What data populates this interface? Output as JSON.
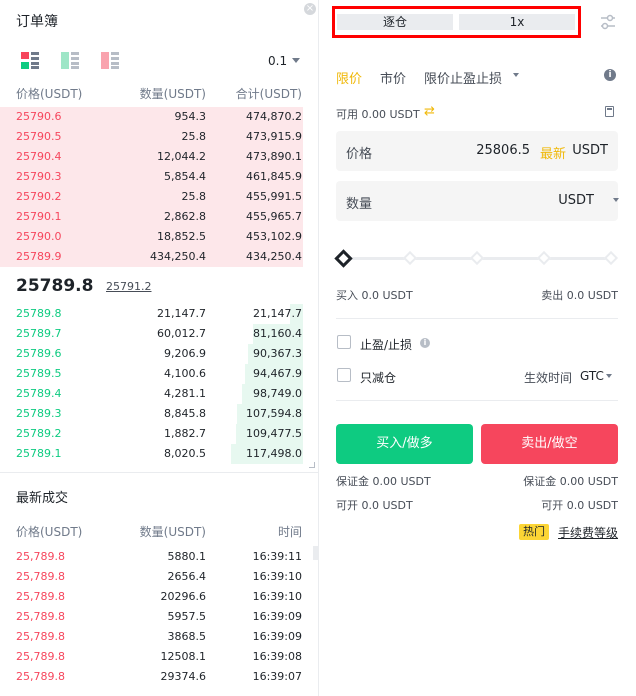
{
  "order_book": {
    "title": "订单簿",
    "close_icon": "close-icon",
    "view_icons": [
      "book-both-icon",
      "book-bids-icon",
      "book-asks-icon"
    ],
    "precision": "0.1",
    "columns": [
      "价格(USDT)",
      "数量(USDT)",
      "合计(USDT)"
    ],
    "asks": [
      {
        "price": "25790.6",
        "qty": "954.3",
        "total": "474,870.2"
      },
      {
        "price": "25790.5",
        "qty": "25.8",
        "total": "473,915.9"
      },
      {
        "price": "25790.4",
        "qty": "12,044.2",
        "total": "473,890.1"
      },
      {
        "price": "25790.3",
        "qty": "5,854.4",
        "total": "461,845.9"
      },
      {
        "price": "25790.2",
        "qty": "25.8",
        "total": "455,991.5"
      },
      {
        "price": "25790.1",
        "qty": "2,862.8",
        "total": "455,965.7"
      },
      {
        "price": "25790.0",
        "qty": "18,852.5",
        "total": "453,102.9"
      },
      {
        "price": "25789.9",
        "qty": "434,250.4",
        "total": "434,250.4"
      }
    ],
    "last_price": "25789.8",
    "mark_price": "25791.2",
    "bids": [
      {
        "price": "25789.8",
        "qty": "21,147.7",
        "total": "21,147.7"
      },
      {
        "price": "25789.7",
        "qty": "60,012.7",
        "total": "81,160.4"
      },
      {
        "price": "25789.6",
        "qty": "9,206.9",
        "total": "90,367.3"
      },
      {
        "price": "25789.5",
        "qty": "4,100.6",
        "total": "94,467.9"
      },
      {
        "price": "25789.4",
        "qty": "4,281.1",
        "total": "98,749.0"
      },
      {
        "price": "25789.3",
        "qty": "8,845.8",
        "total": "107,594.8"
      },
      {
        "price": "25789.2",
        "qty": "1,882.7",
        "total": "109,477.5"
      },
      {
        "price": "25789.1",
        "qty": "8,020.5",
        "total": "117,498.0"
      }
    ]
  },
  "trades": {
    "title": "最新成交",
    "columns": [
      "价格(USDT)",
      "数量(USDT)",
      "时间"
    ],
    "rows": [
      {
        "price": "25,789.8",
        "qty": "5880.1",
        "time": "16:39:11"
      },
      {
        "price": "25,789.8",
        "qty": "2656.4",
        "time": "16:39:10"
      },
      {
        "price": "25,789.8",
        "qty": "20296.6",
        "time": "16:39:10"
      },
      {
        "price": "25,789.8",
        "qty": "5957.5",
        "time": "16:39:09"
      },
      {
        "price": "25,789.8",
        "qty": "3868.5",
        "time": "16:39:09"
      },
      {
        "price": "25,789.8",
        "qty": "12508.1",
        "time": "16:39:08"
      },
      {
        "price": "25,789.8",
        "qty": "29374.6",
        "time": "16:39:07"
      }
    ]
  },
  "order_form": {
    "margin_mode": "逐仓",
    "leverage": "1x",
    "settings_icon": "sliders-icon",
    "tabs": [
      "限价",
      "市价",
      "限价止盈止损"
    ],
    "available": "可用 0.00 USDT",
    "price_field": {
      "label": "价格",
      "value": "25806.5",
      "latest": "最新",
      "unit": "USDT"
    },
    "qty_field": {
      "label": "数量",
      "unit": "USDT"
    },
    "buy_amount": "买入 0.0 USDT",
    "sell_amount": "卖出 0.0 USDT",
    "tp_sl_label": "止盈/止损",
    "reduce_only_label": "只减仓",
    "time_in_force_label": "生效时间",
    "time_in_force_value": "GTC",
    "buy_button": "买入/做多",
    "sell_button": "卖出/做空",
    "buy_margin": "保证金 0.00 USDT",
    "sell_margin": "保证金 0.00 USDT",
    "buy_openable": "可开 0.0 USDT",
    "sell_openable": "可开 0.0 USDT",
    "hot_badge": "热门",
    "fee_link": "手续费等级"
  },
  "colors": {
    "ask": "#f6465d",
    "bid": "#0ecb81",
    "accent": "#f0b90b",
    "highlight_border": "#ff0000"
  }
}
